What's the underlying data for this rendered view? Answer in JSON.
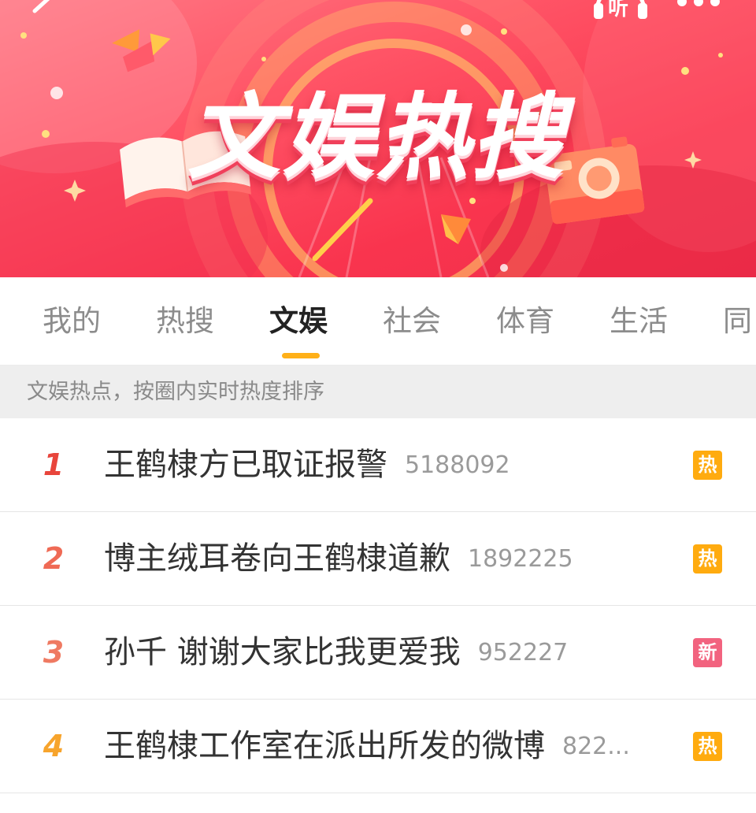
{
  "banner": {
    "title": "文娱热搜",
    "listen_label": "听",
    "colors": {
      "primary": "#f9344e",
      "accent": "#ffd24a"
    },
    "icons": {
      "back": "back-arrow-icon",
      "listen": "headphones-icon",
      "more": "more-dots-icon"
    }
  },
  "tabs": [
    {
      "label": "我的",
      "active": false
    },
    {
      "label": "热搜",
      "active": false
    },
    {
      "label": "文娱",
      "active": true
    },
    {
      "label": "社会",
      "active": false
    },
    {
      "label": "体育",
      "active": false
    },
    {
      "label": "生活",
      "active": false
    },
    {
      "label": "同",
      "active": false
    }
  ],
  "subtitle": "文娱热点，按圈内实时热度排序",
  "list": [
    {
      "rank": "1",
      "title": "王鹤棣方已取证报警",
      "count": "5188092",
      "badge": "热",
      "rank_color": "#e8453c",
      "badge_color": "#ffab0f"
    },
    {
      "rank": "2",
      "title": "博主绒耳卷向王鹤棣道歉",
      "count": "1892225",
      "badge": "热",
      "rank_color": "#ef6a55",
      "badge_color": "#ffab0f"
    },
    {
      "rank": "3",
      "title": "孙千 谢谢大家比我更爱我",
      "count": "952227",
      "badge": "新",
      "rank_color": "#ef7a62",
      "badge_color": "#f2637f"
    },
    {
      "rank": "4",
      "title": "王鹤棣工作室在派出所发的微博",
      "count": "822...",
      "badge": "热",
      "rank_color": "#f7a42c",
      "badge_color": "#ffab0f"
    }
  ]
}
